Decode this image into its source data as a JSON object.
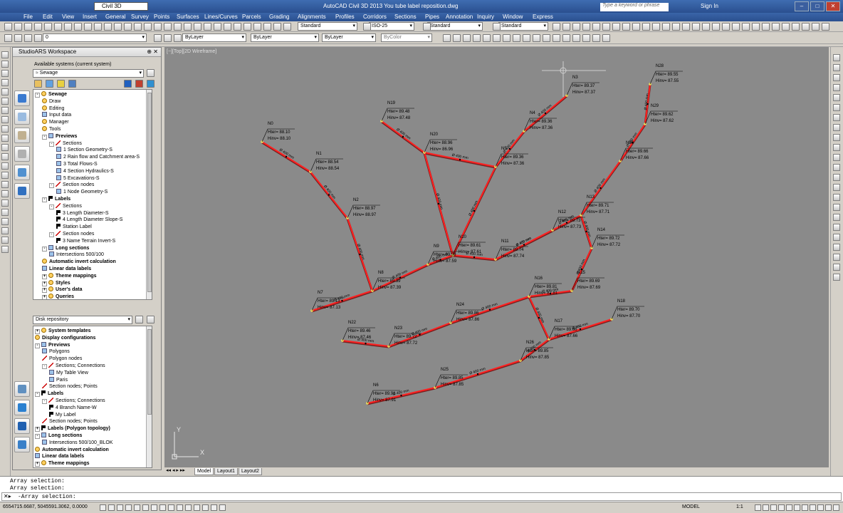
{
  "app": {
    "title": "AutoCAD Civil 3D 2013    You tube label reposition.dwg",
    "workspace": "Civil 3D",
    "search_placeholder": "Type a keyword or phrase",
    "sign_in": "Sign In",
    "logo": "C3D"
  },
  "menu": [
    "File",
    "Edit",
    "View",
    "Insert",
    "General",
    "Survey",
    "Points",
    "Surfaces",
    "Lines/Curves",
    "Parcels",
    "Grading",
    "Alignments",
    "Profiles",
    "Corridors",
    "Sections",
    "Pipes",
    "Annotation",
    "Inquiry",
    "Window",
    "Express"
  ],
  "toolbar": {
    "text_style": "Standard",
    "dim_style": "ISO-25",
    "table_style": "Standard",
    "multileader_style": "Standard",
    "layer_value": "0",
    "color": "ByLayer",
    "linetype": "ByLayer",
    "lineweight": "ByLayer",
    "plotstyle": "ByColor"
  },
  "panel": {
    "title": "StudioARS Workspace",
    "available_label": "Available systems (current system)",
    "system": "Sewage",
    "tree1": [
      {
        "label": "Sewage",
        "indent": 0,
        "bold": true,
        "icon": "gear",
        "exp": "-"
      },
      {
        "label": "Draw",
        "indent": 1,
        "icon": "gear"
      },
      {
        "label": "Editing",
        "indent": 1,
        "icon": "gear"
      },
      {
        "label": "Input data",
        "indent": 1,
        "icon": "doc"
      },
      {
        "label": "Manager",
        "indent": 1,
        "icon": "gear"
      },
      {
        "label": "Tools",
        "indent": 1,
        "icon": "gear"
      },
      {
        "label": "Previews",
        "indent": 1,
        "bold": true,
        "icon": "doc",
        "exp": "-"
      },
      {
        "label": "Sections",
        "indent": 2,
        "icon": "slash",
        "exp": "-"
      },
      {
        "label": "1 Section Geometry-S",
        "indent": 3,
        "icon": "doc"
      },
      {
        "label": "2 Rain flow and Catchment area-S",
        "indent": 3,
        "icon": "doc"
      },
      {
        "label": "3 Total Flows-S",
        "indent": 3,
        "icon": "doc"
      },
      {
        "label": "4 Section Hydraulics-S",
        "indent": 3,
        "icon": "doc"
      },
      {
        "label": "5 Excavations-S",
        "indent": 3,
        "icon": "doc"
      },
      {
        "label": "Section nodes",
        "indent": 2,
        "icon": "slash",
        "exp": "-"
      },
      {
        "label": "1 Node Geometry-S",
        "indent": 3,
        "icon": "doc"
      },
      {
        "label": "Labels",
        "indent": 1,
        "bold": true,
        "icon": "flag",
        "exp": "-"
      },
      {
        "label": "Sections",
        "indent": 2,
        "icon": "slash",
        "exp": "-"
      },
      {
        "label": "3 Length Diameter-S",
        "indent": 3,
        "icon": "flag"
      },
      {
        "label": "4 Length Diameter Slope-S",
        "indent": 3,
        "icon": "flag"
      },
      {
        "label": "Station Label",
        "indent": 3,
        "icon": "flag"
      },
      {
        "label": "Section nodes",
        "indent": 2,
        "icon": "slash",
        "exp": "-"
      },
      {
        "label": "3 Name Terrain Invert-S",
        "indent": 3,
        "icon": "flag"
      },
      {
        "label": "Long sections",
        "indent": 1,
        "bold": true,
        "icon": "doc",
        "exp": "-"
      },
      {
        "label": "Intersections 500/100",
        "indent": 2,
        "icon": "doc"
      },
      {
        "label": "Automatic invert calculation",
        "indent": 1,
        "bold": true,
        "icon": "gear"
      },
      {
        "label": "Linear data labels",
        "indent": 1,
        "bold": true,
        "icon": "doc"
      },
      {
        "label": "Theme mappings",
        "indent": 1,
        "bold": true,
        "icon": "gear",
        "exp": "+"
      },
      {
        "label": "Styles",
        "indent": 1,
        "bold": true,
        "icon": "gear",
        "exp": "+"
      },
      {
        "label": "User's data",
        "indent": 1,
        "bold": true,
        "icon": "gear",
        "exp": "+"
      },
      {
        "label": "Queries",
        "indent": 1,
        "bold": true,
        "icon": "gear",
        "exp": "+"
      }
    ],
    "repo_label": "Disk repository",
    "tree2": [
      {
        "label": "System templates",
        "indent": 0,
        "bold": true,
        "icon": "gear",
        "exp": "+"
      },
      {
        "label": "Display configurations",
        "indent": 0,
        "bold": true,
        "icon": "gear"
      },
      {
        "label": "Previews",
        "indent": 0,
        "bold": true,
        "icon": "doc",
        "exp": "-"
      },
      {
        "label": "Polygons",
        "indent": 1,
        "icon": "doc"
      },
      {
        "label": "Polygon nodes",
        "indent": 1,
        "icon": "slash"
      },
      {
        "label": "Sections; Connections",
        "indent": 1,
        "icon": "slash",
        "exp": "-"
      },
      {
        "label": "My Table View",
        "indent": 2,
        "icon": "doc"
      },
      {
        "label": "Paris",
        "indent": 2,
        "icon": "doc"
      },
      {
        "label": "Section nodes; Points",
        "indent": 1,
        "icon": "slash"
      },
      {
        "label": "Labels",
        "indent": 0,
        "bold": true,
        "icon": "flag",
        "exp": "-"
      },
      {
        "label": "Sections; Connections",
        "indent": 1,
        "icon": "slash",
        "exp": "-"
      },
      {
        "label": "4 Branch Name-W",
        "indent": 2,
        "icon": "flag"
      },
      {
        "label": "My Label",
        "indent": 2,
        "icon": "flag"
      },
      {
        "label": "Section nodes; Points",
        "indent": 1,
        "icon": "slash"
      },
      {
        "label": "Labels (Polygon topology)",
        "indent": 0,
        "bold": true,
        "icon": "flag",
        "exp": "+"
      },
      {
        "label": "Long sections",
        "indent": 0,
        "bold": true,
        "icon": "doc",
        "exp": "-"
      },
      {
        "label": "Intersections 500/100_BLOK",
        "indent": 1,
        "icon": "doc"
      },
      {
        "label": "Automatic invert calculation",
        "indent": 0,
        "bold": true,
        "icon": "gear"
      },
      {
        "label": "Linear data labels",
        "indent": 0,
        "bold": true,
        "icon": "doc"
      },
      {
        "label": "Theme mappings",
        "indent": 0,
        "bold": true,
        "icon": "gear",
        "exp": "+"
      }
    ]
  },
  "viewport": {
    "label": "[−][Top][2D Wireframe]",
    "ucs_x": "X",
    "ucs_y": "Y"
  },
  "network": {
    "nodes": [
      {
        "name": "N0",
        "hter": "Hter= 88.10",
        "hinv": "Hinv= 88.10"
      },
      {
        "name": "N1",
        "hter": "Hter= 88.54",
        "hinv": "Hinv= 88.54"
      },
      {
        "name": "N2",
        "hter": "Hter= 88.97",
        "hinv": "Hinv= 88.97"
      },
      {
        "name": "N3",
        "hter": "Hter= 89.37",
        "hinv": "Hinv= 87.37"
      },
      {
        "name": "N4",
        "hter": "Hter= 89.36",
        "hinv": "Hinv= 87.36"
      },
      {
        "name": "N5",
        "hter": "Hter= 89.36",
        "hinv": "Hinv= 87.36"
      },
      {
        "name": "N19",
        "hter": "Hter= 89.48",
        "hinv": "Hinv= 87.48"
      },
      {
        "name": "N20",
        "hter": "Hter= 88.96",
        "hinv": "Hinv= 86.96"
      },
      {
        "name": "N28",
        "hter": "Hter= 89.55",
        "hinv": "Hinv= 87.55"
      },
      {
        "name": "N29",
        "hter": "Hter= 89.62",
        "hinv": "Hinv= 87.62"
      },
      {
        "name": "N30",
        "hter": "Hter= 89.66",
        "hinv": "Hinv= 87.66"
      },
      {
        "name": "N13",
        "hter": "Hter= 89.71",
        "hinv": "Hinv= 87.71"
      },
      {
        "name": "N14",
        "hter": "Hter= 89.72",
        "hinv": "Hinv= 87.72"
      },
      {
        "name": "N15",
        "hter": "Hter= 89.69",
        "hinv": "Hinv= 87.69"
      },
      {
        "name": "N10",
        "hter": "Hter= 89.61",
        "hinv": "Hinv= 87.61"
      },
      {
        "name": "N9",
        "hter": "Hter= 89.59",
        "hinv": "Hinv= 87.59"
      },
      {
        "name": "N8",
        "hter": "Hter= 89.39",
        "hinv": "Hinv= 87.39"
      },
      {
        "name": "N7",
        "hter": "Hter= 89.13",
        "hinv": "Hinv= 87.13"
      },
      {
        "name": "N16",
        "hter": "Hter= 89.81",
        "hinv": "Hinv= 87.81"
      },
      {
        "name": "N24",
        "hter": "Hter= 89.86",
        "hinv": "Hinv= 87.86"
      },
      {
        "name": "N17",
        "hter": "Hter= 89.66",
        "hinv": "Hinv= 87.66"
      },
      {
        "name": "N18",
        "hter": "Hter= 89.70",
        "hinv": "Hinv= 87.70"
      },
      {
        "name": "N22",
        "hter": "Hter= 89.46",
        "hinv": "Hinv= 87.46"
      },
      {
        "name": "N23",
        "hter": "Hter= 89.72",
        "hinv": "Hinv= 87.72"
      },
      {
        "name": "N26",
        "hter": "Hter= 89.85",
        "hinv": "Hinv= 87.85"
      },
      {
        "name": "N25",
        "hter": "Hter= 89.85",
        "hinv": "Hinv= 87.85"
      },
      {
        "name": "N6",
        "hter": "Hter= 89.91",
        "hinv": "Hinv= 87.91"
      },
      {
        "name": "N11",
        "hter": "Hter= 89.74",
        "hinv": "Hinv= 87.74"
      },
      {
        "name": "N12",
        "hter": "Hter= 89.73",
        "hinv": "Hinv= 87.73"
      }
    ],
    "pipe_label": "Ø 400 mm"
  },
  "tabs": [
    "Model",
    "Layout1",
    "Layout2"
  ],
  "command": {
    "history": [
      "Array selection:",
      "Array selection:"
    ],
    "prompt": "-Array selection:"
  },
  "status": {
    "coords": "6554715.6687, 5045591.3062, 0.0000",
    "model": "MODEL",
    "scale": "1:1"
  },
  "colors": {
    "pipe": "#ff2020",
    "label": "#000000",
    "canvas": "#8a8a8a"
  }
}
